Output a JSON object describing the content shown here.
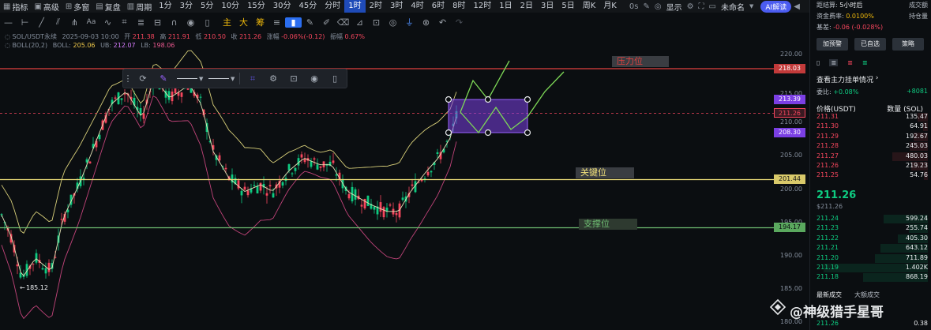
{
  "topbar": {
    "items": [
      {
        "icon": "grid-icon",
        "label": "指标"
      },
      {
        "icon": "chart-icon",
        "label": "高级"
      },
      {
        "icon": "multiwindow-icon",
        "label": "多窗"
      },
      {
        "icon": "replay-icon",
        "label": "复盘"
      },
      {
        "icon": "calendar-icon",
        "label": "周期"
      }
    ],
    "intervals": [
      "1分",
      "3分",
      "5分",
      "10分",
      "15分",
      "30分",
      "45分",
      "分时",
      "1时",
      "2时",
      "3时",
      "4时",
      "6时",
      "8时",
      "12时",
      "1日",
      "2日",
      "3日",
      "5日",
      "周K",
      "月K"
    ],
    "active_interval": "1时",
    "seconds_label": "0s",
    "show_label": "显示",
    "layout_name": "未命名",
    "ai_label": "AI解读"
  },
  "drawbar": {
    "text_tools": [
      {
        "label": "主",
        "color": "#f0b90b"
      },
      {
        "label": "大",
        "color": "#f0b90b"
      },
      {
        "label": "筹",
        "color": "#f0b90b"
      }
    ]
  },
  "legend": {
    "symbol": "SOL/USDT永续",
    "datetime": "2025-09-03 10:00",
    "open_label": "开",
    "open": "211.38",
    "high_label": "高",
    "high": "211.91",
    "low_label": "低",
    "low": "210.50",
    "close_label": "收",
    "close": "211.26",
    "change_label": "涨幅",
    "change": "-0.06%(-0.12)",
    "amplitude_label": "振幅",
    "amplitude": "0.67%",
    "boll_name": "BOLL(20,2)",
    "boll_label": "BOLL:",
    "boll": "205.06",
    "ub_label": "UB:",
    "ub": "212.07",
    "lb_label": "LB:",
    "lb": "198.06"
  },
  "axis": {
    "ticks": [
      "220.00",
      "215.00",
      "210.00",
      "205.00",
      "200.00",
      "195.00",
      "190.00",
      "185.00",
      "180.00"
    ],
    "tags": {
      "resistance": "218.03",
      "box_top": "213.39",
      "current": "211.26",
      "box_bottom": "208.30",
      "key": "201.44",
      "support": "194.17"
    },
    "low_marker": "185.12"
  },
  "annotations": {
    "resistance": "压力位",
    "key": "关键位",
    "support": "支撑位"
  },
  "colors": {
    "up": "#0ecb81",
    "down": "#f6465d",
    "resistance_line": "#e0403f",
    "key_line": "#f0e07a",
    "support_line": "#6fbf73",
    "box": "#7b3fe4",
    "projection": "#7ed957"
  },
  "panel": {
    "countdown_label": "距结算:",
    "countdown": "5小时后",
    "turnover_label": "成交额",
    "funding_label": "资金费率:",
    "funding": "0.0100%",
    "open_interest_label": "持仓量",
    "basis_label": "基差:",
    "basis": "-0.06 (-0.028%)",
    "buttons": [
      "加预警",
      "已自选",
      "策略"
    ],
    "depth_link": "查看主力挂单情况",
    "ratio_label": "委比:",
    "ratio": "+0.08%",
    "ratio_right": "+8081",
    "col_price": "价格(USDT)",
    "col_qty": "数量 (SOL)",
    "asks": [
      {
        "price": "211.31",
        "qty": "135.47"
      },
      {
        "price": "211.30",
        "qty": "64.91"
      },
      {
        "price": "211.29",
        "qty": "192.67"
      },
      {
        "price": "211.28",
        "qty": "245.03"
      },
      {
        "price": "211.27",
        "qty": "480.03"
      },
      {
        "price": "211.26",
        "qty": "219.23"
      },
      {
        "price": "211.25",
        "qty": "54.76"
      }
    ],
    "last_price": "211.26",
    "mark_price": "$211.26",
    "bids": [
      {
        "price": "211.24",
        "qty": "599.24"
      },
      {
        "price": "211.23",
        "qty": "255.74"
      },
      {
        "price": "211.22",
        "qty": "405.30"
      },
      {
        "price": "211.21",
        "qty": "643.12"
      },
      {
        "price": "211.20",
        "qty": "711.89"
      },
      {
        "price": "211.19",
        "qty": "1.402K"
      },
      {
        "price": "211.18",
        "qty": "868.19"
      }
    ],
    "tab_trades": "最新成交",
    "tab_large": "大额成交",
    "trades": [
      {
        "price": "211.26",
        "qty": "0.38"
      }
    ]
  },
  "watermark": "@神级猎手星哥"
}
